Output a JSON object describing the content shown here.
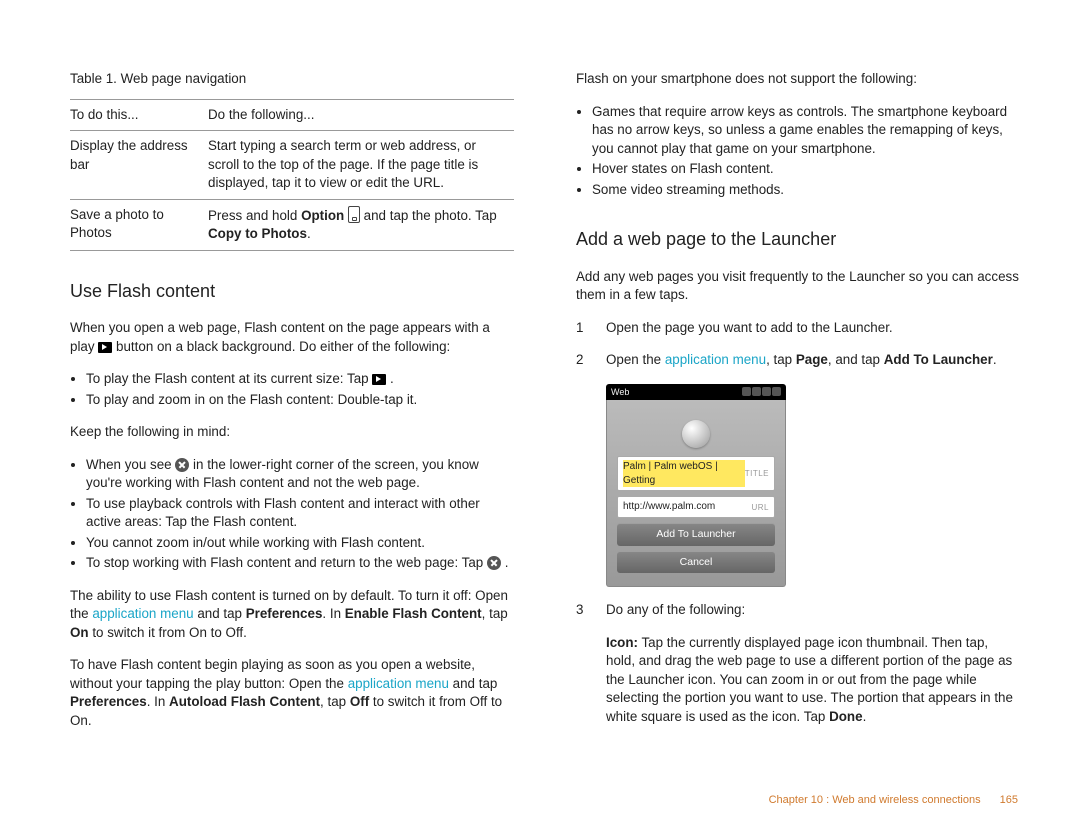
{
  "left": {
    "table_caption": "Table 1.  Web page navigation",
    "th1": "To do this...",
    "th2": "Do the following...",
    "r1c1": "Display the address bar",
    "r1c2": "Start typing a search term or web address, or scroll to the top of the page. If the page title is displayed, tap it to view or edit the URL.",
    "r2c1": "Save a photo to Photos",
    "r2c2a": "Press and hold ",
    "r2c2_option": "Option",
    "r2c2b": " and tap the photo. Tap ",
    "r2c2_copy": "Copy to Photos",
    "h_flash": "Use Flash content",
    "p1a": "When you open a web page, Flash content on the page appears with a play ",
    "p1b": " button on a black background. Do either of the following:",
    "b1_li1a": "To play the Flash content at its current size: Tap ",
    "b1_li2": "To play and zoom in on the Flash content: Double-tap it.",
    "p_keep": "Keep the following in mind:",
    "b2_li1a": "When you see ",
    "b2_li1b": " in the lower-right corner of the screen, you know you're working with Flash content and not the web page.",
    "b2_li2": "To use playback controls with Flash content and interact with other active areas: Tap the Flash content.",
    "b2_li3": "You cannot zoom in/out while working with Flash content.",
    "b2_li4a": "To stop working with Flash content and return to the web page: Tap ",
    "p2a": "The ability to use Flash content is turned on by default. To turn it off: Open the ",
    "p2_link1": "application menu",
    "p2b": " and tap ",
    "p2_pref": "Preferences",
    "p2c": ". In ",
    "p2_enable": "Enable Flash Content",
    "p2d": ", tap ",
    "p2_on": "On",
    "p2e": " to switch it from On to Off.",
    "p3a": "To have Flash content begin playing as soon as you open a website, without your tapping the play button: Open the ",
    "p3_link": "application menu",
    "p3b": " and tap ",
    "p3_pref": "Preferences",
    "p3c": ". In ",
    "p3_auto": "Autoload Flash Content",
    "p3d": ", tap ",
    "p3_off": "Off",
    "p3e": " to switch it from Off to On."
  },
  "right": {
    "p_intro": "Flash on your smartphone does not support the following:",
    "li1": "Games that require arrow keys as controls. The smartphone keyboard has no arrow keys, so unless a game enables the remapping of keys, you cannot play that game on your smartphone.",
    "li2": "Hover states on Flash content.",
    "li3": "Some video streaming methods.",
    "h_add": "Add a web page to the Launcher",
    "p_add": "Add any web pages you visit frequently to the Launcher so you can access them in a few taps.",
    "s1": "Open the page you want to add to the Launcher.",
    "s2a": "Open the ",
    "s2_link": "application menu",
    "s2b": ", tap ",
    "s2_page": "Page",
    "s2c": ", and tap ",
    "s2_add": "Add To Launcher",
    "shot": {
      "bar_title": "Web",
      "title_val": "Palm | Palm webOS | Getting",
      "title_lbl": "TITLE",
      "url_val": "http://www.palm.com",
      "url_lbl": "URL",
      "btn1": "Add To Launcher",
      "btn2": "Cancel"
    },
    "s3": "Do any of the following:",
    "s3_icon_lbl": "Icon:",
    "s3_icon_txt": " Tap the currently displayed page icon thumbnail. Then tap, hold, and drag the web page to use a different portion of the page as the Launcher icon. You can zoom in or out from the page while selecting the portion you want to use. The portion that appears in the white square is used as the icon. Tap ",
    "s3_done": "Done"
  },
  "footer": {
    "chap": "Chapter 10  :  Web and wireless connections",
    "page": "165"
  }
}
